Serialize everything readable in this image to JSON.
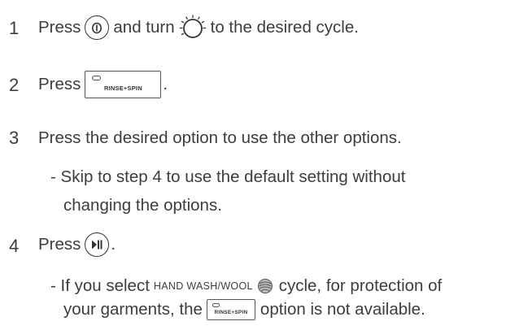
{
  "steps": [
    {
      "number": "1",
      "parts": [
        "Press",
        "and turn",
        "to the desired cycle."
      ],
      "icons": [
        "power-icon",
        "cycle-dial-icon"
      ]
    },
    {
      "number": "2",
      "parts": [
        "Press",
        "."
      ],
      "button_label": "RINSE+SPIN"
    },
    {
      "number": "3",
      "text": "Press the desired option to use the other options.",
      "note_line1": "- Skip to step 4 to use the default setting without",
      "note_line2": "changing the options."
    },
    {
      "number": "4",
      "parts": [
        "Press",
        "."
      ],
      "icons": [
        "start-pause-icon"
      ],
      "note_part1": "- If you select",
      "note_cycle": "HAND WASH/WOOL",
      "note_part2": "cycle, for protection of",
      "note_part3": "your garments, the",
      "note_button_label": "RINSE+SPIN",
      "note_part4": "option is not available."
    }
  ],
  "icons": {
    "power": "power-icon",
    "dial": "cycle-dial-icon",
    "start_pause": "start-pause-icon",
    "wool": "wool-icon"
  }
}
